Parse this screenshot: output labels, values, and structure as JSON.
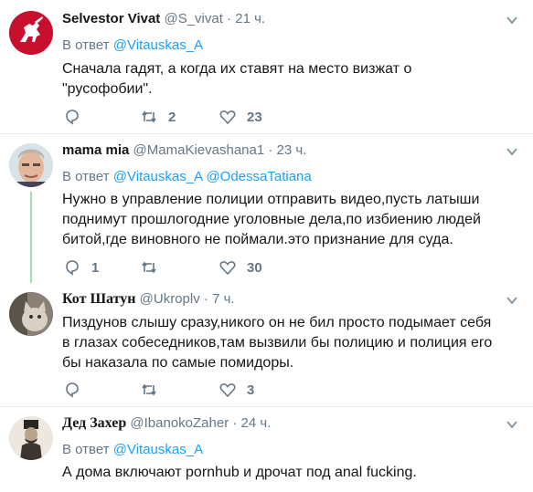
{
  "tweets": [
    {
      "name": "Selvestor Vivat",
      "handle": "@S_vivat",
      "time": "21 ч.",
      "reply_prefix": "В ответ",
      "reply_to": [
        "@Vitauskas_A"
      ],
      "text": [
        "Сначала гадят, а когда их ставят на место визжат о",
        "\"русофобии\"."
      ],
      "replies": "",
      "retweets": "2",
      "likes": "23",
      "avatar_icon": "knight-coat-of-arms-icon"
    },
    {
      "name": "mama mia",
      "handle": "@MamaKievashana1",
      "time": "23 ч.",
      "reply_prefix": "В ответ",
      "reply_to": [
        "@Vitauskas_A",
        "@OdessaTatiana"
      ],
      "text": [
        "Нужно в управление полиции отправить видео,пусть латыши",
        "поднимут прошлогодние уголовные дела,по избиению людей",
        "битой,где виновного не поймали.это признание для суда."
      ],
      "replies": "1",
      "retweets": "",
      "likes": "30",
      "avatar_icon": "man-portrait-icon"
    },
    {
      "name": "Кот Шатун",
      "handle": "@Ukroplv",
      "time": "7 ч.",
      "text": [
        "Пиздунов слышу сразу,никого он не бил просто подымает себя",
        "в глазах собеседников,там вызвили бы полицию и полиция его",
        "бы наказала по самые помидоры."
      ],
      "replies": "",
      "retweets": "",
      "likes": "3",
      "avatar_icon": "cat-photo-icon"
    },
    {
      "name": "Дед Захер",
      "handle": "@IbanokoZaher",
      "time": "24 ч.",
      "reply_prefix": "В ответ",
      "reply_to": [
        "@Vitauskas_A"
      ],
      "text": [
        "А дома включают pornhub и дрочат под anal fucking."
      ],
      "avatar_icon": "cossack-portrait-icon"
    }
  ],
  "colors": {
    "accent": "#1da1f2",
    "muted": "#657786",
    "thread_line": "#9be1b3",
    "divider": "#e6ecf0"
  }
}
